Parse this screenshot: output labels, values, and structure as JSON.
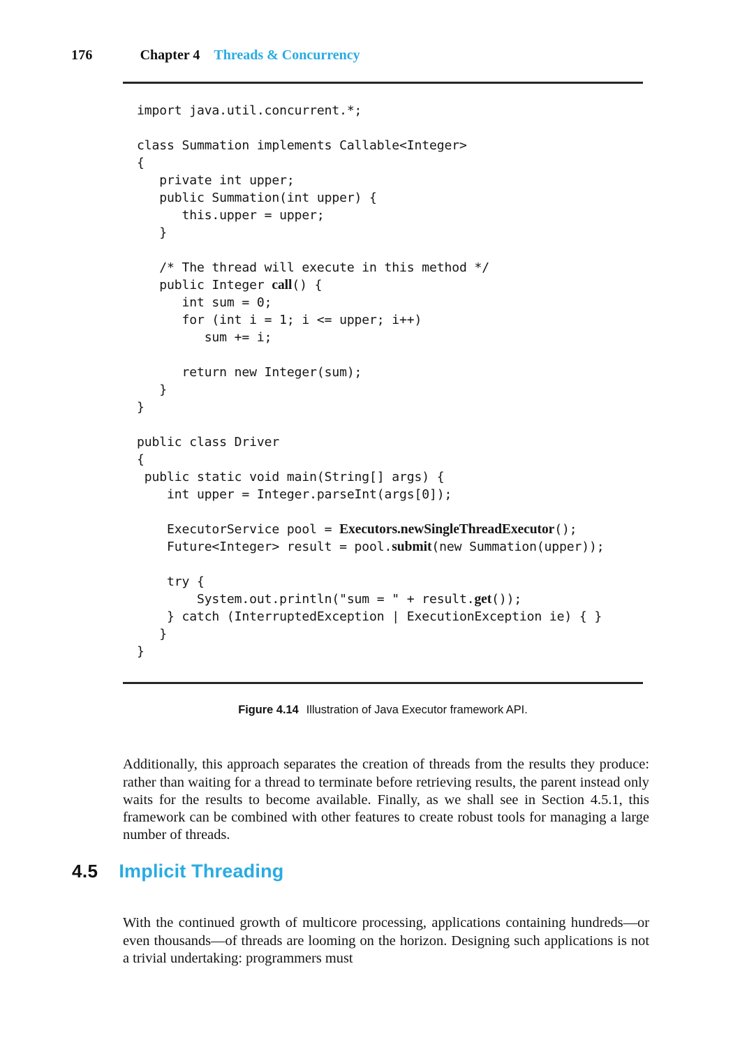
{
  "page": {
    "folio": "176",
    "chapter_label": "Chapter 4",
    "chapter_title": "Threads & Concurrency",
    "accent_color": "#29ABE2",
    "text_color": "#111111",
    "background_color": "#ffffff"
  },
  "figure": {
    "caption_label": "Figure 4.14",
    "caption_text": "Illustration of Java Executor framework API.",
    "code_lines": [
      {
        "text": "import java.util.concurrent.*;"
      },
      {
        "text": ""
      },
      {
        "text": "class Summation implements Callable<Integer>"
      },
      {
        "text": "{"
      },
      {
        "text": "   private int upper;"
      },
      {
        "text": "   public Summation(int upper) {"
      },
      {
        "text": "      this.upper = upper;"
      },
      {
        "text": "   }"
      },
      {
        "text": ""
      },
      {
        "text": "   /* The thread will execute in this method */"
      },
      {
        "text": "   public Integer ",
        "bold": "call",
        "tail": "() {"
      },
      {
        "text": "      int sum = 0;"
      },
      {
        "text": "      for (int i = 1; i <= upper; i++)"
      },
      {
        "text": "         sum += i;"
      },
      {
        "text": ""
      },
      {
        "text": "      return new Integer(sum);"
      },
      {
        "text": "   }"
      },
      {
        "text": "}"
      },
      {
        "text": ""
      },
      {
        "text": "public class Driver"
      },
      {
        "text": "{"
      },
      {
        "text": " public static void main(String[] args) {"
      },
      {
        "text": "    int upper = Integer.parseInt(args[0]);"
      },
      {
        "text": ""
      },
      {
        "text": "    ExecutorService pool = ",
        "bold": "Executors.newSingleThreadExecutor",
        "tail": "();"
      },
      {
        "text": "    Future<Integer> result = pool.",
        "bold": "submit",
        "tail": "(new Summation(upper));"
      },
      {
        "text": ""
      },
      {
        "text": "    try {"
      },
      {
        "text": "        System.out.println(\"sum = \" + result.",
        "bold": "get",
        "tail": "());"
      },
      {
        "text": "    } catch (InterruptedException | ExecutionException ie) { }"
      },
      {
        "text": "   }"
      },
      {
        "text": "}"
      }
    ]
  },
  "section": {
    "number": "4.5",
    "title": "Implicit Threading"
  },
  "paragraphs": {
    "after_figure": "Additionally, this approach separates the creation of threads from the results they produce: rather than waiting for a thread to terminate before retrieving results, the parent instead only waits for the results to become available. Finally, as we shall see in Section 4.5.1, this framework can be combined with other features to create robust tools for managing a large number of threads.",
    "section_intro": "With the continued growth of multicore processing, applications containing hundreds—or even thousands—of threads are looming on the horizon. Designing such applications is not a trivial undertaking: programmers must"
  }
}
